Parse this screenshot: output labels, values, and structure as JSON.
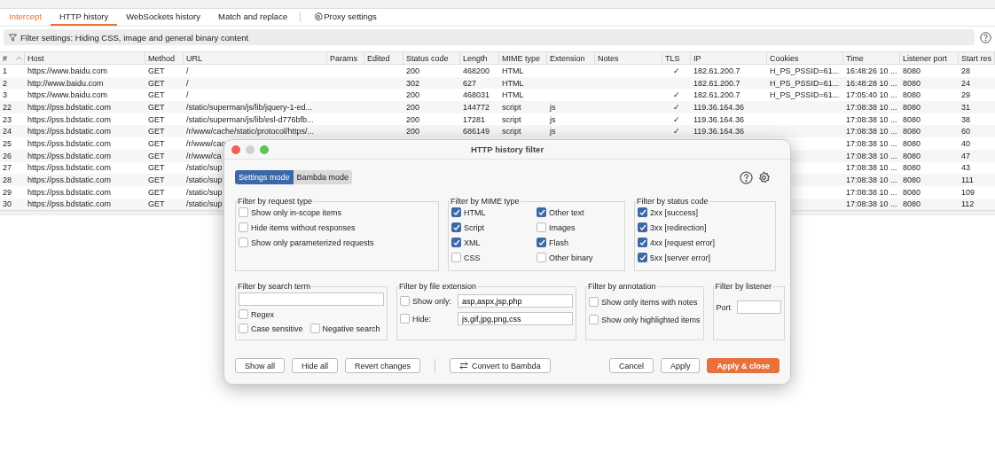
{
  "proxy_tabs": [
    {
      "label": "Intercept",
      "selected": false,
      "alert": true,
      "kind": "tab"
    },
    {
      "label": "HTTP history",
      "selected": true,
      "alert": false,
      "kind": "tab"
    },
    {
      "label": "WebSockets history",
      "selected": false,
      "alert": false,
      "kind": "tab"
    },
    {
      "label": "Match and replace",
      "selected": false,
      "alert": false,
      "kind": "tab"
    },
    {
      "label": "Proxy settings",
      "selected": false,
      "alert": false,
      "kind": "settings"
    }
  ],
  "filter_bar": {
    "text": "Filter settings: Hiding CSS, image and general binary content"
  },
  "table": {
    "columns": [
      {
        "label": "#",
        "sorted": true
      },
      {
        "label": "Host",
        "sorted": false
      },
      {
        "label": "Method",
        "sorted": false
      },
      {
        "label": "URL",
        "sorted": false
      },
      {
        "label": "Params",
        "sorted": false
      },
      {
        "label": "Edited",
        "sorted": false
      },
      {
        "label": "Status code",
        "sorted": false
      },
      {
        "label": "Length",
        "sorted": false
      },
      {
        "label": "MIME type",
        "sorted": false
      },
      {
        "label": "Extension",
        "sorted": false
      },
      {
        "label": "Notes",
        "sorted": false
      },
      {
        "label": "TLS",
        "sorted": false
      },
      {
        "label": "IP",
        "sorted": false
      },
      {
        "label": "Cookies",
        "sorted": false
      },
      {
        "label": "Time",
        "sorted": false
      },
      {
        "label": "Listener port",
        "sorted": false
      },
      {
        "label": "Start res",
        "sorted": false
      }
    ],
    "rows": [
      {
        "cells": [
          "1",
          "https://www.baidu.com",
          "GET",
          "/",
          null,
          null,
          "200",
          "468200",
          "HTML",
          null,
          null,
          "✓",
          "182.61.200.7",
          "H_PS_PSSID=61...",
          "16:48:26 10 ...",
          "8080",
          "28"
        ]
      },
      {
        "cells": [
          "2",
          "http://www.baidu.com",
          "GET",
          "/",
          null,
          null,
          "302",
          "627",
          "HTML",
          null,
          null,
          null,
          "182.61.200.7",
          "H_PS_PSSID=61...",
          "16:48:28 10 ...",
          "8080",
          "24"
        ]
      },
      {
        "cells": [
          "3",
          "https://www.baidu.com",
          "GET",
          "/",
          null,
          null,
          "200",
          "468031",
          "HTML",
          null,
          null,
          "✓",
          "182.61.200.7",
          "H_PS_PSSID=61...",
          "17:05:40 10 ...",
          "8080",
          "29"
        ]
      },
      {
        "cells": [
          "22",
          "https://pss.bdstatic.com",
          "GET",
          "/static/superman/js/lib/jquery-1-ed...",
          null,
          null,
          "200",
          "144772",
          "script",
          "js",
          null,
          "✓",
          "119.36.164.36",
          null,
          "17:08:38 10 ...",
          "8080",
          "31"
        ]
      },
      {
        "cells": [
          "23",
          "https://pss.bdstatic.com",
          "GET",
          "/static/superman/js/lib/esl-d776bfb...",
          null,
          null,
          "200",
          "17281",
          "script",
          "js",
          null,
          "✓",
          "119.36.164.36",
          null,
          "17:08:38 10 ...",
          "8080",
          "38"
        ]
      },
      {
        "cells": [
          "24",
          "https://pss.bdstatic.com",
          "GET",
          "/r/www/cache/static/protocol/https/...",
          null,
          null,
          "200",
          "686149",
          "script",
          "js",
          null,
          "✓",
          "119.36.164.36",
          null,
          "17:08:38 10 ...",
          "8080",
          "60"
        ]
      },
      {
        "cells": [
          "25",
          "https://pss.bdstatic.com",
          "GET",
          "/r/www/cac",
          null,
          null,
          null,
          null,
          null,
          null,
          null,
          null,
          null,
          null,
          "17:08:38 10 ...",
          "8080",
          "40"
        ]
      },
      {
        "cells": [
          "26",
          "https://pss.bdstatic.com",
          "GET",
          "/r/www/ca",
          null,
          null,
          null,
          null,
          null,
          null,
          null,
          null,
          null,
          null,
          "17:08:38 10 ...",
          "8080",
          "47"
        ]
      },
      {
        "cells": [
          "27",
          "https://pss.bdstatic.com",
          "GET",
          "/static/sup",
          null,
          null,
          null,
          null,
          null,
          null,
          null,
          null,
          null,
          null,
          "17:08:38 10 ...",
          "8080",
          "43"
        ]
      },
      {
        "cells": [
          "28",
          "https://pss.bdstatic.com",
          "GET",
          "/static/sup",
          null,
          null,
          null,
          null,
          null,
          null,
          null,
          null,
          null,
          null,
          "17:08:38 10 ...",
          "8080",
          "111"
        ]
      },
      {
        "cells": [
          "29",
          "https://pss.bdstatic.com",
          "GET",
          "/static/sup",
          null,
          null,
          null,
          null,
          null,
          null,
          null,
          null,
          null,
          null,
          "17:08:38 10 ...",
          "8080",
          "109"
        ]
      },
      {
        "cells": [
          "30",
          "https://pss.bdstatic.com",
          "GET",
          "/static/sup",
          null,
          null,
          null,
          null,
          null,
          null,
          null,
          null,
          null,
          null,
          "17:08:38 10 ...",
          "8080",
          "112"
        ]
      }
    ]
  },
  "dialog": {
    "title": "HTTP history filter",
    "modes": [
      {
        "label": "Settings mode",
        "selected": true
      },
      {
        "label": "Bambda mode",
        "selected": false
      }
    ],
    "top_groups": [
      {
        "title": "Filter by request type",
        "items": [
          {
            "label": "Show only in-scope items",
            "checked": false
          },
          {
            "label": "Hide items without responses",
            "checked": false
          },
          {
            "label": "Show only parameterized requests",
            "checked": false
          }
        ]
      },
      {
        "title": "Filter by MIME type",
        "items": [
          {
            "label": "HTML",
            "checked": true
          },
          {
            "label": "Other text",
            "checked": true
          },
          {
            "label": "Script",
            "checked": true
          },
          {
            "label": "Images",
            "checked": false
          },
          {
            "label": "XML",
            "checked": true
          },
          {
            "label": "Flash",
            "checked": true
          },
          {
            "label": "CSS",
            "checked": false
          },
          {
            "label": "Other binary",
            "checked": false
          }
        ]
      },
      {
        "title": "Filter by status code",
        "items": [
          {
            "label": "2xx  [success]",
            "checked": true
          },
          {
            "label": "3xx  [redirection]",
            "checked": true
          },
          {
            "label": "4xx  [request error]",
            "checked": true
          },
          {
            "label": "5xx  [server error]",
            "checked": true
          }
        ]
      }
    ],
    "search": {
      "title": "Filter by search term",
      "options": [
        {
          "label": "Regex",
          "checked": false
        },
        {
          "label": "Case sensitive",
          "checked": false
        },
        {
          "label": "Negative search",
          "checked": false
        }
      ]
    },
    "file_extension": {
      "title": "Filter by file extension",
      "rows": [
        {
          "label": "Show only:",
          "checked": false,
          "value": "asp,aspx,jsp,php"
        },
        {
          "label": "Hide:",
          "checked": false,
          "value": "js,gif,jpg,png,css"
        }
      ]
    },
    "annotation": {
      "title": "Filter by annotation",
      "items": [
        {
          "label": "Show only items with notes",
          "checked": false
        },
        {
          "label": "Show only highlighted items",
          "checked": false
        }
      ]
    },
    "listener": {
      "title": "Filter by listener",
      "label": "Port"
    },
    "buttons": [
      {
        "label": "Show all",
        "kind": "plain"
      },
      {
        "label": "Hide all",
        "kind": "plain"
      },
      {
        "label": "Revert changes",
        "kind": "plain"
      },
      {
        "label": "Convert to Bambda",
        "kind": "convert"
      },
      {
        "label": "Cancel",
        "kind": "plain"
      },
      {
        "label": "Apply",
        "kind": "plain"
      },
      {
        "label": "Apply & close",
        "kind": "primary"
      }
    ]
  }
}
